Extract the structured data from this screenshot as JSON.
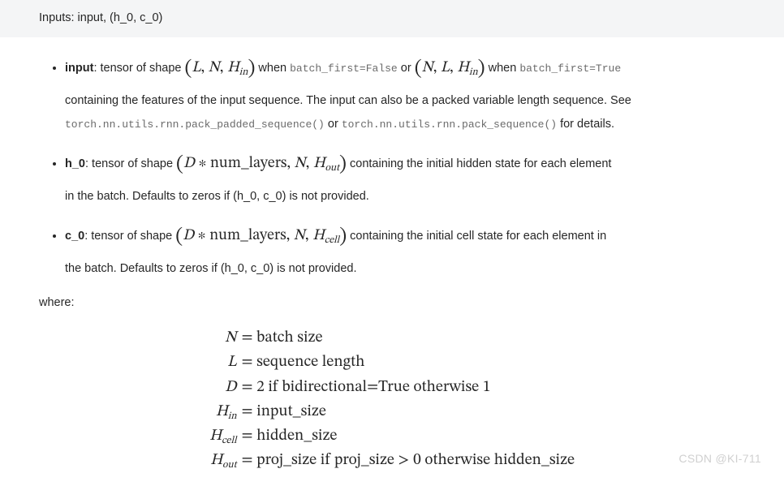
{
  "header": {
    "text": "Inputs: input, (h_0, c_0)"
  },
  "items": [
    {
      "name": "input",
      "pre": ": tensor of shape ",
      "shape1": {
        "open": "(",
        "a": "L",
        "b": "N",
        "c_base": "H",
        "c_sub": "in",
        "close": ")"
      },
      "mid1": " when ",
      "code1": "batch_first=False",
      "mid2": " or ",
      "shape2": {
        "open": "(",
        "a": "N",
        "b": "L",
        "c_base": "H",
        "c_sub": "in",
        "close": ")"
      },
      "mid3": " when ",
      "code2": "batch_first=True",
      "line2a": "containing the features of the input sequence. The input can also be a packed variable length sequence. See",
      "code3": "torch.nn.utils.rnn.pack_padded_sequence()",
      "mid4": " or ",
      "code4": "torch.nn.utils.rnn.pack_sequence()",
      "tail": " for details."
    },
    {
      "name": "h_0",
      "pre": ": tensor of shape ",
      "shape": {
        "open": "(",
        "a": "D",
        "star": " ∗ ",
        "b_rm": "num_layers",
        "c": "N",
        "d_base": "H",
        "d_sub": "out",
        "close": ")"
      },
      "mid": " containing the initial hidden state for each element",
      "line2": "in the batch. Defaults to zeros if (h_0, c_0) is not provided."
    },
    {
      "name": "c_0",
      "pre": ": tensor of shape ",
      "shape": {
        "open": "(",
        "a": "D",
        "star": " ∗ ",
        "b_rm": "num_layers",
        "c": "N",
        "d_base": "H",
        "d_sub": "cell",
        "close": ")"
      },
      "mid": " containing the initial cell state for each element in",
      "line2": "the batch. Defaults to zeros if (h_0, c_0) is not provided."
    }
  ],
  "where_label": "where:",
  "eqns": [
    {
      "lhs_it": "N",
      "eq": " = ",
      "rhs": "batch size"
    },
    {
      "lhs_it": "L",
      "eq": " = ",
      "rhs": "sequence length"
    },
    {
      "lhs_it": "D",
      "eq": " = ",
      "rhs": "2 if bidirectional=True otherwise 1"
    },
    {
      "lhs_base": "H",
      "lhs_sub": "in",
      "eq": " = ",
      "rhs": "input_size"
    },
    {
      "lhs_base": "H",
      "lhs_sub": "cell",
      "eq": " = ",
      "rhs": "hidden_size"
    },
    {
      "lhs_base": "H",
      "lhs_sub": "out",
      "eq": " = ",
      "rhs": "proj_size if proj_size > 0 otherwise hidden_size"
    }
  ],
  "watermark": "CSDN @KI-711"
}
